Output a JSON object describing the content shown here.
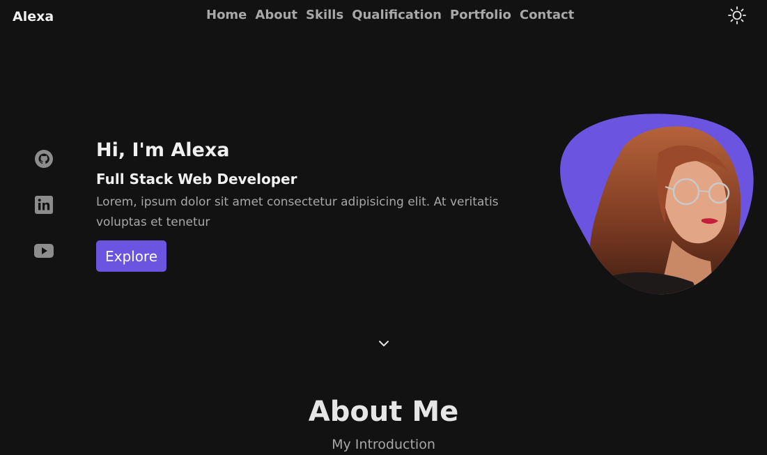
{
  "header": {
    "logo": "Alexa",
    "nav": [
      {
        "label": "Home"
      },
      {
        "label": "About"
      },
      {
        "label": "Skills"
      },
      {
        "label": "Qualification"
      },
      {
        "label": "Portfolio"
      },
      {
        "label": "Contact"
      }
    ],
    "theme_icon": "sun-icon"
  },
  "social": [
    {
      "icon": "github-icon"
    },
    {
      "icon": "linkedin-icon"
    },
    {
      "icon": "youtube-icon"
    }
  ],
  "hero": {
    "title": "Hi, I'm Alexa",
    "subtitle": "Full Stack Web Developer",
    "description": "Lorem, ipsum dolor sit amet consectetur adipisicing elit. At veritatis voluptas et tenetur",
    "button_label": "Explore"
  },
  "scroll_icon": "chevron-down-icon",
  "about": {
    "title": "About Me",
    "subtitle": "My Introduction"
  },
  "colors": {
    "background": "#121212",
    "accent": "#6b55e0",
    "text": "#e6e6e6",
    "muted": "#a8a8a8"
  }
}
